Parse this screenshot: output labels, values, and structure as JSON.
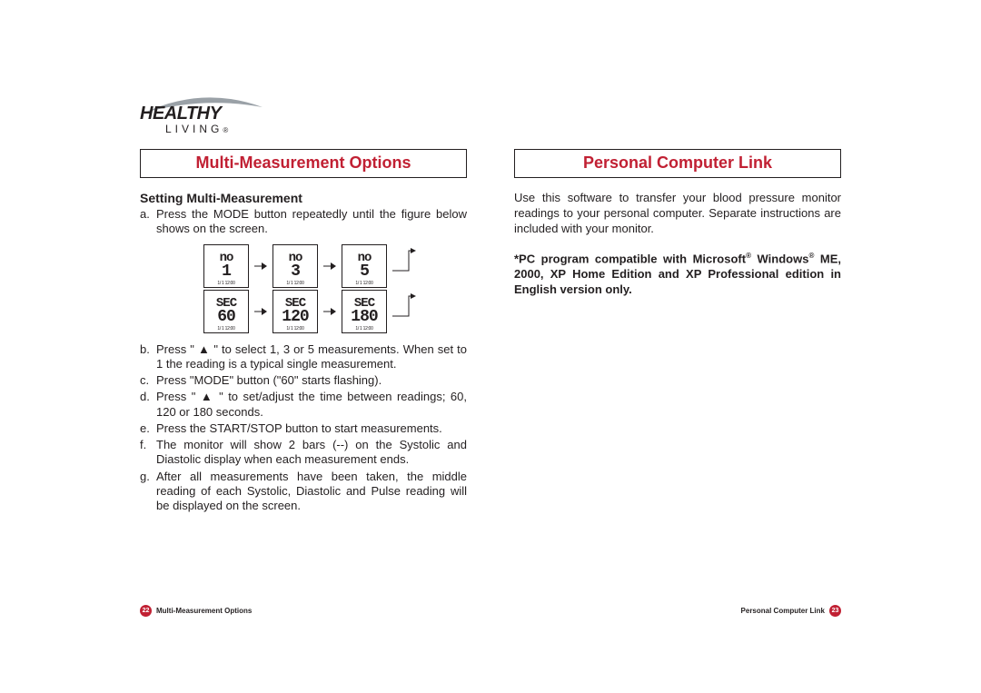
{
  "logo": {
    "line1": "HEALTHY",
    "line2": "LIVING",
    "reg": "®"
  },
  "left": {
    "title": "Multi-Measurement Options",
    "subhead": "Setting Multi-Measurement",
    "steps": [
      {
        "label": "a.",
        "text": "Press the MODE button repeatedly until the figure below shows on the screen."
      },
      {
        "label": "b.",
        "text": "Press \" ▲ \" to select 1, 3 or 5 measurements. When set to 1 the reading is a typical single measurement."
      },
      {
        "label": "c.",
        "text": "Press \"MODE\" button (\"60\" starts flashing)."
      },
      {
        "label": "d.",
        "text": "Press \" ▲ \" to set/adjust the time between readings; 60, 120 or 180 seconds."
      },
      {
        "label": "e.",
        "text": "Press the START/STOP button to start measurements."
      },
      {
        "label": "f.",
        "text": "The monitor will show 2 bars (--) on the Systolic and Diastolic display when each measurement ends."
      },
      {
        "label": "g.",
        "text": "After all measurements have been taken, the middle reading of each Systolic, Diastolic and Pulse reading will be displayed on the screen."
      }
    ],
    "lcd": {
      "row1": [
        {
          "l1": "no",
          "l2": "1",
          "date": "1/ 1 12:00"
        },
        {
          "l1": "no",
          "l2": "3",
          "date": "1/ 1 12:00"
        },
        {
          "l1": "no",
          "l2": "5",
          "date": "1/ 1 12:00"
        }
      ],
      "row2": [
        {
          "l1": "SEC",
          "l2": "60",
          "date": "1/ 1 12:00"
        },
        {
          "l1": "SEC",
          "l2": "120",
          "date": "1/ 1 12:00"
        },
        {
          "l1": "SEC",
          "l2": "180",
          "date": "1/ 1 12:00"
        }
      ]
    },
    "footer": {
      "page": "22",
      "label": "Multi-Measurement Options"
    }
  },
  "right": {
    "title": "Personal Computer Link",
    "intro": "Use this software to transfer your blood pressure monitor readings to your personal computer. Separate instructions are included with your monitor.",
    "note_parts": {
      "p1": "*PC program compatible with Microsoft",
      "reg1": "®",
      "p2": " Windows",
      "reg2": "®",
      "p3": " ME, 2000, XP Home Edition and XP Professional edition in English version only."
    },
    "footer": {
      "label": "Personal Computer Link",
      "page": "23"
    }
  }
}
